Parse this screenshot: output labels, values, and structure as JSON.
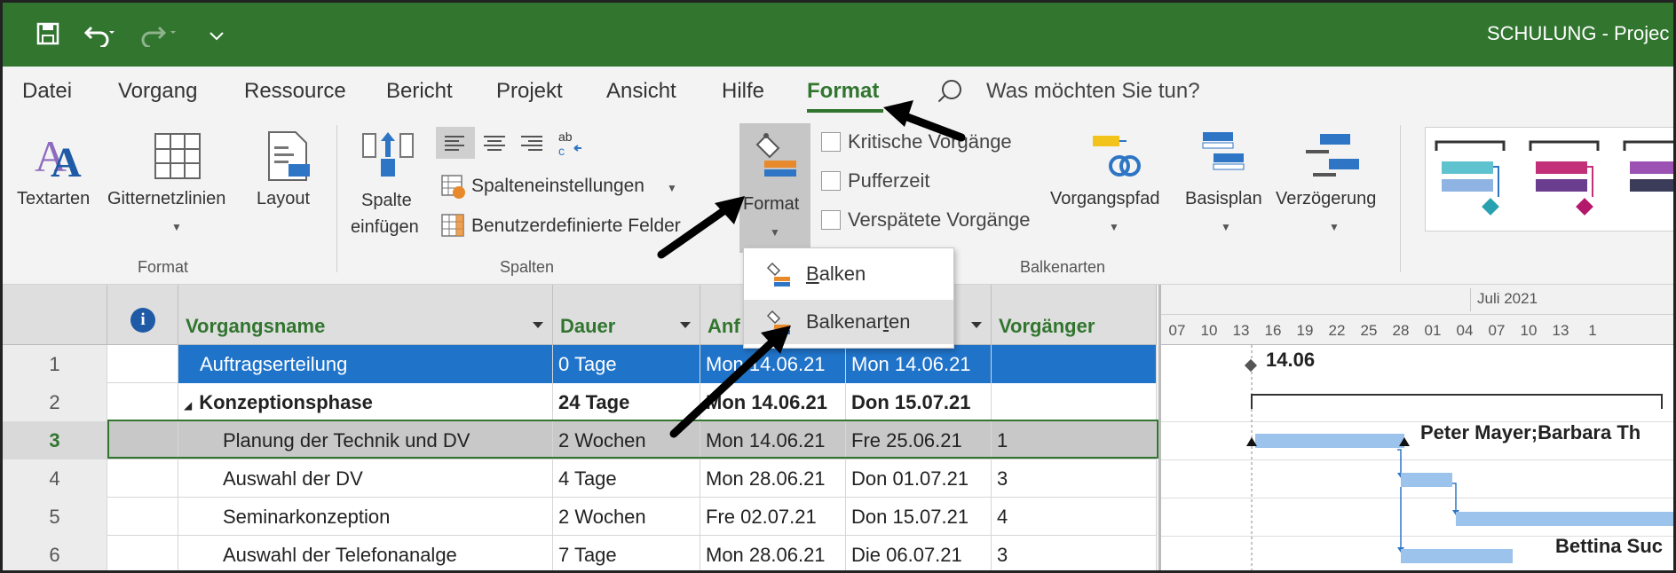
{
  "window": {
    "title": "SCHULUNG  -  Projec"
  },
  "quick_access": {
    "save_icon": "save-icon",
    "undo_icon": "undo-icon",
    "redo_icon": "redo-icon",
    "customize_icon": "customize-icon"
  },
  "menu": {
    "items": [
      "Datei",
      "Vorgang",
      "Ressource",
      "Bericht",
      "Projekt",
      "Ansicht",
      "Hilfe",
      "Format"
    ],
    "active": "Format",
    "search_placeholder": "Was möchten Sie tun?"
  },
  "ribbon": {
    "format_group": {
      "label": "Format",
      "textarten": "Textarten",
      "gitternetzlinien": "Gitternetzlinien",
      "layout": "Layout"
    },
    "spalten_group": {
      "label": "Spalten",
      "spalte_line1": "Spalte",
      "spalte_line2": "einfügen",
      "spalteneinstellungen": "Spalteneinstellungen",
      "benutzerdefinierte": "Benutzerdefinierte Felder"
    },
    "format_button": "Format",
    "balkenarten_group": {
      "label": "Balkenarten",
      "kritische": "Kritische Vorgänge",
      "pufferzeit": "Pufferzeit",
      "verspaetete": "Verspätete Vorgänge",
      "vorgangspfad": "Vorgangspfad",
      "basisplan": "Basisplan",
      "verzoegerung": "Verzögerung"
    }
  },
  "dropdown": {
    "items": [
      {
        "prefix": "",
        "accel": "B",
        "rest": "alken"
      },
      {
        "prefix": "Balkenar",
        "accel": "t",
        "rest": "en"
      }
    ]
  },
  "table": {
    "headers": {
      "info_icon": "info-icon",
      "name": "Vorgangsname",
      "dauer": "Dauer",
      "anfang": "Anf",
      "vorgaenger": "Vorgänger"
    },
    "rows": [
      {
        "id": "1",
        "name": "Auftragserteilung",
        "dauer": "0 Tage",
        "anfang": "Mon 14.06.21",
        "ende": "Mon 14.06.21",
        "vorg": ""
      },
      {
        "id": "2",
        "name": "Konzeptionsphase",
        "dauer": "24 Tage",
        "anfang": "Mon 14.06.21",
        "ende": "Don 15.07.21",
        "vorg": ""
      },
      {
        "id": "3",
        "name": "Planung der Technik und DV",
        "dauer": "2 Wochen",
        "anfang": "Mon 14.06.21",
        "ende": "Fre 25.06.21",
        "vorg": "1"
      },
      {
        "id": "4",
        "name": "Auswahl der DV",
        "dauer": "4 Tage",
        "anfang": "Mon 28.06.21",
        "ende": "Don 01.07.21",
        "vorg": "3"
      },
      {
        "id": "5",
        "name": "Seminarkonzeption",
        "dauer": "2 Wochen",
        "anfang": "Fre 02.07.21",
        "ende": "Don 15.07.21",
        "vorg": "4"
      },
      {
        "id": "6",
        "name": "Auswahl der Telefonanalge",
        "dauer": "7 Tage",
        "anfang": "Mon 28.06.21",
        "ende": "Die 06.07.21",
        "vorg": "3"
      }
    ]
  },
  "gantt": {
    "month": "Juli 2021",
    "ticks": [
      "07",
      "10",
      "13",
      "16",
      "19",
      "22",
      "25",
      "28",
      "01",
      "04",
      "07",
      "10",
      "13",
      "1"
    ],
    "milestone_label": "14.06",
    "row3_label": "Peter Mayer;Barbara Th",
    "row6_label": "Bettina Suc"
  },
  "colors": {
    "accent": "#31752f",
    "selection": "#1f73c9",
    "bar": "#9cc3ec"
  }
}
